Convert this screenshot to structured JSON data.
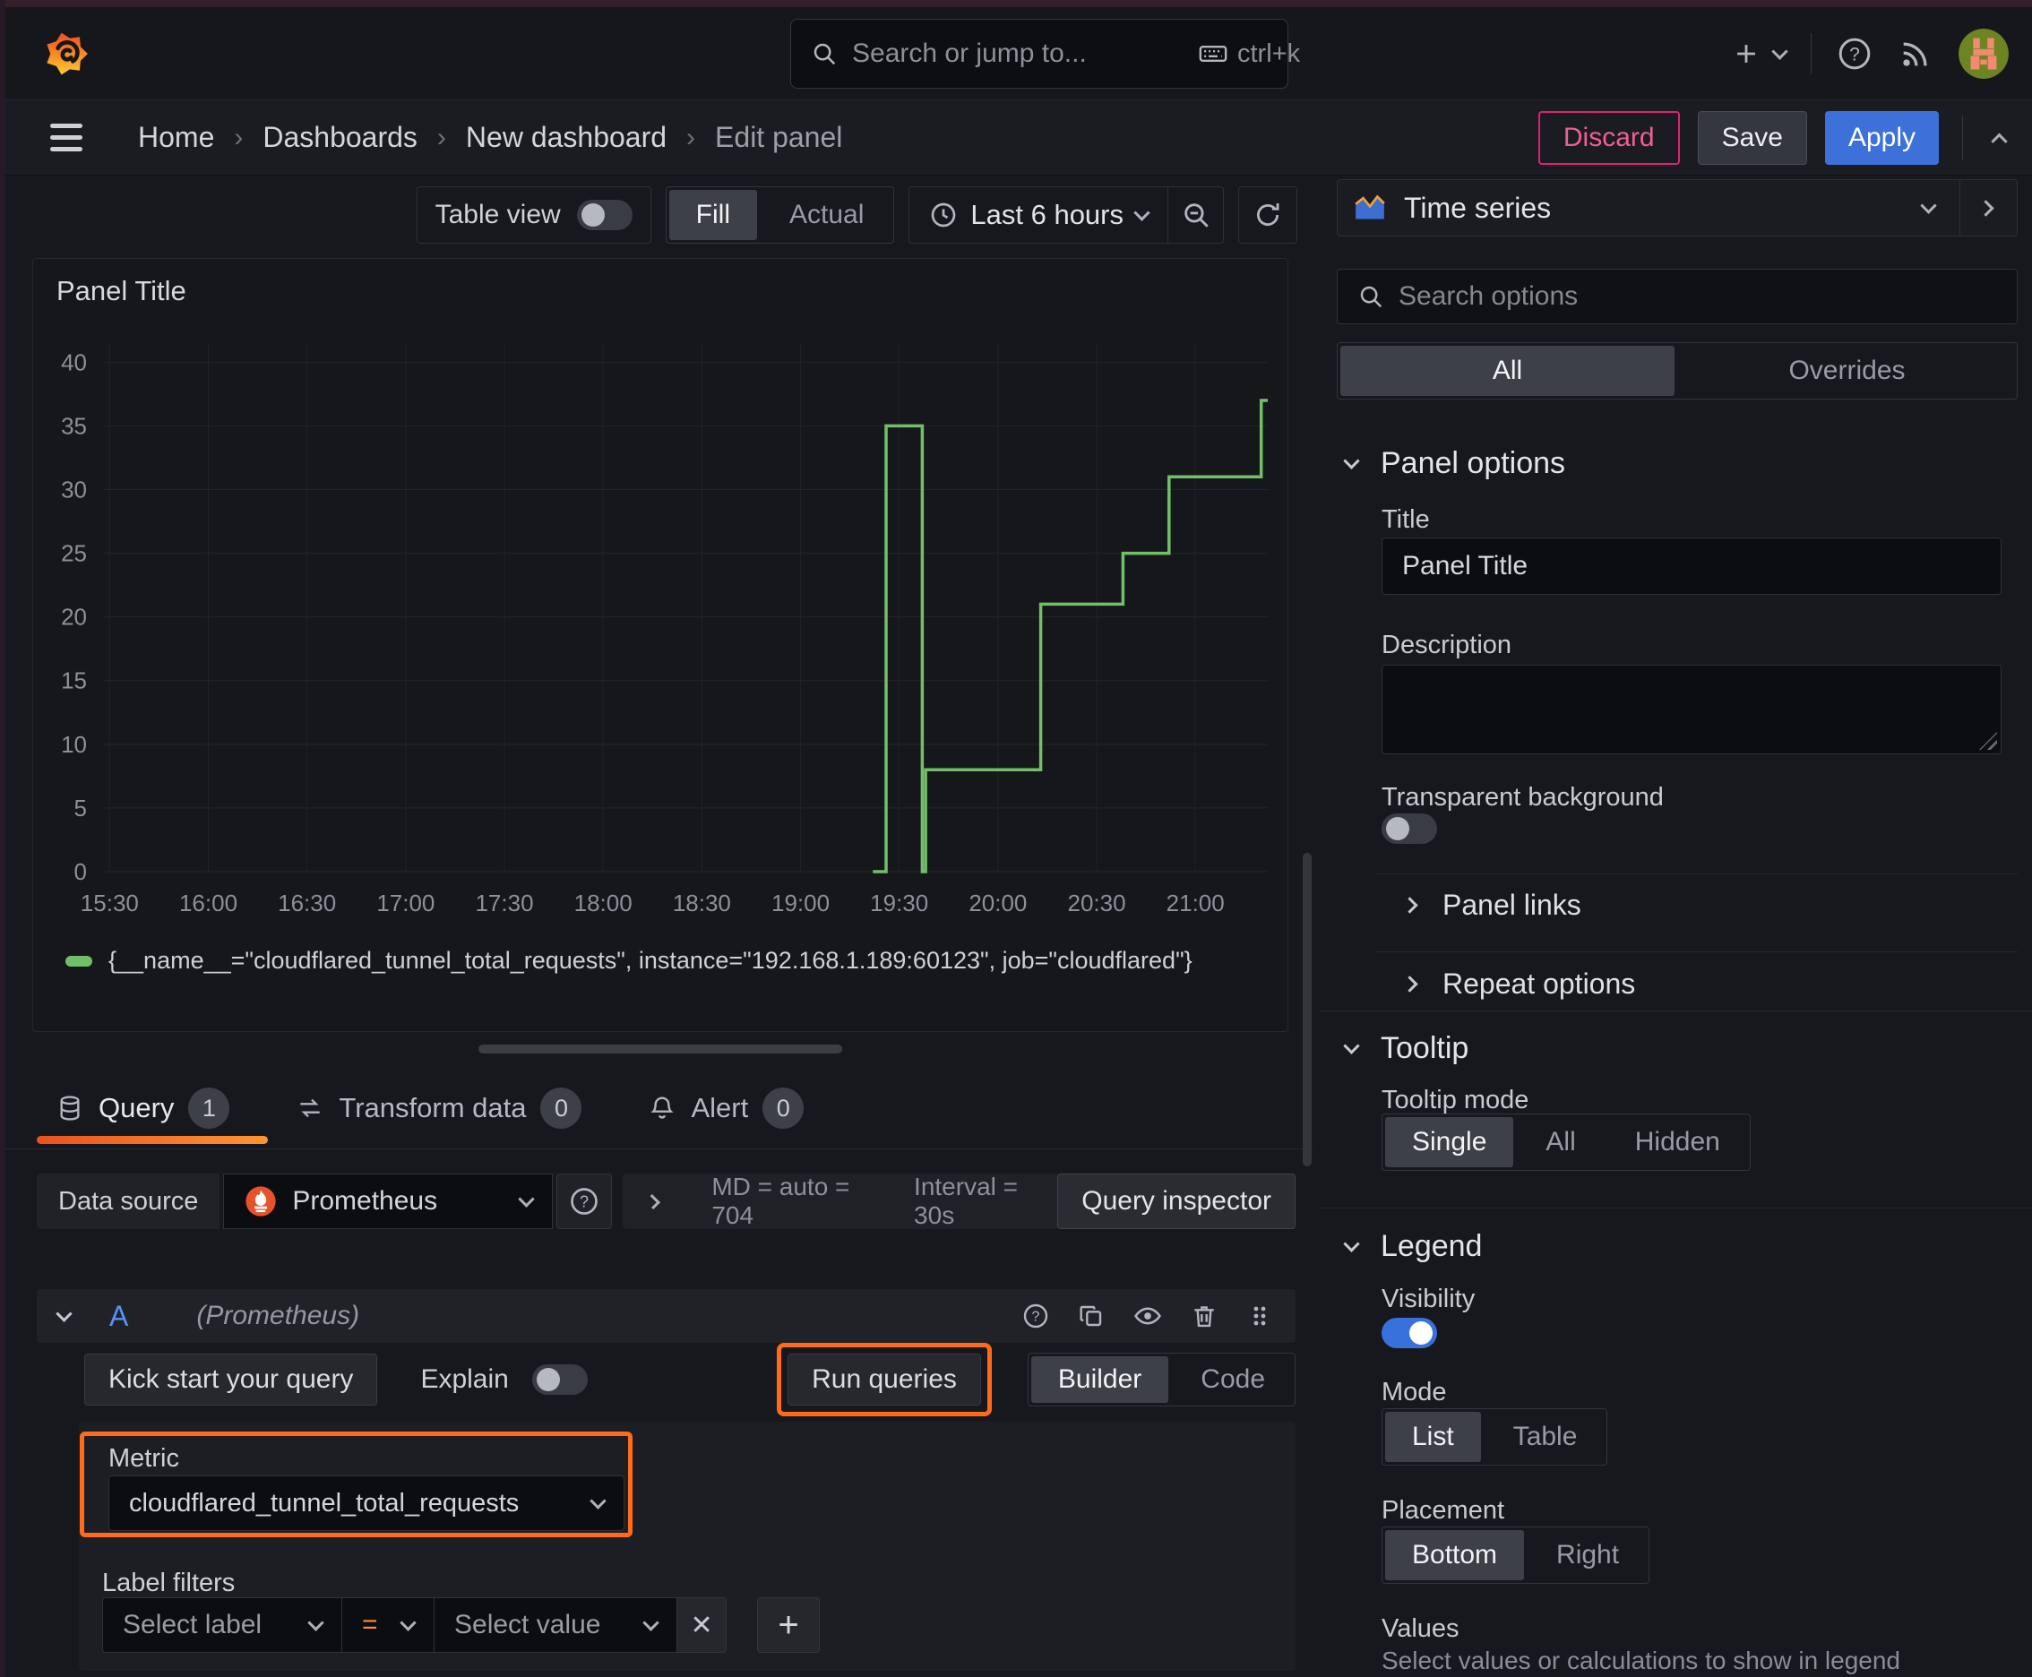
{
  "topnav": {
    "search_placeholder": "Search or jump to...",
    "search_shortcut": "ctrl+k"
  },
  "breadcrumb": {
    "items": [
      "Home",
      "Dashboards",
      "New dashboard",
      "Edit panel"
    ]
  },
  "actions": {
    "discard": "Discard",
    "save": "Save",
    "apply": "Apply"
  },
  "toolbar": {
    "table_view_label": "Table view",
    "fill_label": "Fill",
    "actual_label": "Actual",
    "time_range_label": "Last 6 hours"
  },
  "panel": {
    "title": "Panel Title"
  },
  "chart_data": {
    "type": "line",
    "title": "Panel Title",
    "x_range": [
      "15:28",
      "21:22"
    ],
    "y_range": [
      0,
      41.5
    ],
    "x_ticks": [
      "15:30",
      "16:00",
      "16:30",
      "17:00",
      "17:30",
      "18:00",
      "18:30",
      "19:00",
      "19:30",
      "20:00",
      "20:30",
      "21:00"
    ],
    "y_ticks": [
      0,
      5,
      10,
      15,
      20,
      25,
      30,
      35,
      40
    ],
    "grid": true,
    "legend_position": "bottom",
    "series": [
      {
        "name": "{__name__=\"cloudflared_tunnel_total_requests\", instance=\"192.168.1.189:60123\", job=\"cloudflared\"}",
        "color": "#73bf69",
        "points": [
          [
            "19:22",
            0
          ],
          [
            "19:26",
            0
          ],
          [
            "19:26",
            35
          ],
          [
            "19:37",
            35
          ],
          [
            "19:37",
            0
          ],
          [
            "19:38",
            0
          ],
          [
            "19:38",
            8
          ],
          [
            "20:13",
            8
          ],
          [
            "20:13",
            21
          ],
          [
            "20:38",
            21
          ],
          [
            "20:38",
            25
          ],
          [
            "20:52",
            25
          ],
          [
            "20:52",
            31
          ],
          [
            "21:20",
            31
          ],
          [
            "21:20",
            37
          ],
          [
            "21:22",
            37
          ]
        ]
      }
    ]
  },
  "tabs": {
    "query_label": "Query",
    "query_count": "1",
    "transform_label": "Transform data",
    "transform_count": "0",
    "alert_label": "Alert",
    "alert_count": "0"
  },
  "datasource": {
    "label": "Data source",
    "name": "Prometheus",
    "max_data_points": "MD = auto = 704",
    "interval": "Interval = 30s",
    "inspector_label": "Query inspector"
  },
  "editor": {
    "ref_id": "A",
    "ds_hint": "(Prometheus)",
    "kick_start_label": "Kick start your query",
    "explain_label": "Explain",
    "run_queries_label": "Run queries",
    "builder_label": "Builder",
    "code_label": "Code",
    "metric_label": "Metric",
    "metric_value": "cloudflared_tunnel_total_requests",
    "label_filters_label": "Label filters",
    "select_label_placeholder": "Select label",
    "operator": "=",
    "select_value_placeholder": "Select value"
  },
  "options": {
    "visualization": "Time series",
    "search_placeholder": "Search options",
    "tab_all": "All",
    "tab_overrides": "Overrides",
    "panel_options": {
      "header": "Panel options",
      "title_label": "Title",
      "title_value": "Panel Title",
      "description_label": "Description",
      "transparent_label": "Transparent background"
    },
    "panel_links_label": "Panel links",
    "repeat_options_label": "Repeat options",
    "tooltip": {
      "header": "Tooltip",
      "mode_label": "Tooltip mode",
      "modes": [
        "Single",
        "All",
        "Hidden"
      ],
      "selected_mode": "Single"
    },
    "legend": {
      "header": "Legend",
      "visibility_label": "Visibility",
      "mode_label": "Mode",
      "modes": [
        "List",
        "Table"
      ],
      "selected_mode": "List",
      "placement_label": "Placement",
      "placements": [
        "Bottom",
        "Right"
      ],
      "selected_placement": "Bottom",
      "values_label": "Values",
      "values_help": "Select values or calculations to show in legend"
    }
  },
  "colors": {
    "series_green": "#73bf69",
    "accent_orange": "#ff780a",
    "highlight_orange": "#ff6b18",
    "primary_blue": "#3d71d9",
    "danger_pink": "#e0226e"
  }
}
